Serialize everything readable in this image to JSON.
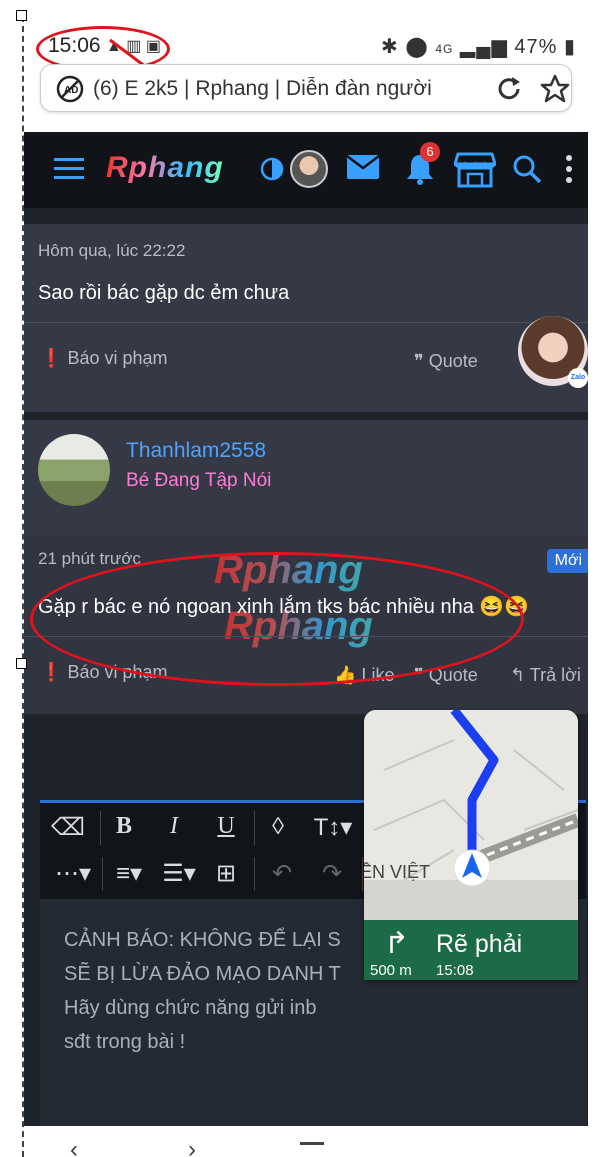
{
  "status": {
    "time": "15:06",
    "network": "4G",
    "battery": "47%"
  },
  "browser": {
    "url_text": "(6) E 2k5 | Rphang | Diễn đàn người"
  },
  "header": {
    "logo": "Rphang",
    "notification_count": "6"
  },
  "post1": {
    "time": "Hôm qua, lúc 22:22",
    "text": "Sao rồi bác gặp dc ẻm chưa",
    "report": "Báo vi phạm",
    "quote": "Quote",
    "zalo": "Zalo"
  },
  "post2": {
    "username": "Thanhlam2558",
    "user_title": "Bé Đang Tập Nói",
    "time": "21 phút trước",
    "new_badge": "Mới",
    "text": "Gặp r bác e nó ngoan xinh lắm tks bác nhiều nha 😆😆",
    "report": "Báo vi phạm",
    "like": "Like",
    "quote": "Quote",
    "reply": "Trả lời",
    "watermark": "Rphang"
  },
  "editor": {
    "warning_lines": [
      "CẢNH BÁO: KHÔNG ĐỂ LẠI S",
      "SẼ BỊ LỪA ĐẢO MẠO DANH T",
      "Hãy dùng chức năng gửi inb",
      "sđt trong bài !"
    ]
  },
  "navigation": {
    "street": "ỀN VIỆT",
    "instruction": "Rẽ phải",
    "distance": "500 m",
    "eta": "15:08"
  },
  "colors": {
    "accent": "#2d6fd8",
    "username": "#4fa3ff",
    "usertitle": "#ff7bd5",
    "annotation": "#e0121b"
  }
}
